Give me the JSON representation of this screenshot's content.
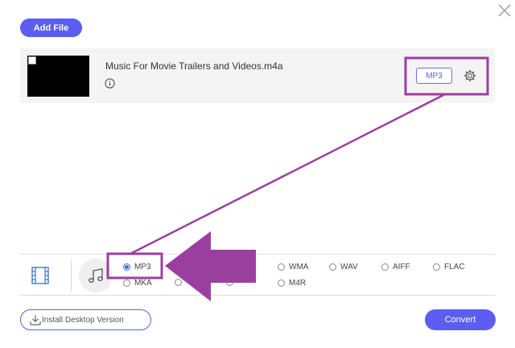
{
  "header": {
    "add_file_label": "Add File"
  },
  "file": {
    "name": "Music For Movie Trailers and Videos.m4a",
    "output_format": "MP3"
  },
  "format_panel": {
    "options": [
      {
        "label": "MP3",
        "selected": true
      },
      {
        "label": "WMA",
        "selected": false
      },
      {
        "label": "WAV",
        "selected": false
      },
      {
        "label": "AIFF",
        "selected": false
      },
      {
        "label": "FLAC",
        "selected": false
      },
      {
        "label": "MKA",
        "selected": false
      },
      {
        "label": "M4R",
        "selected": false
      }
    ]
  },
  "footer": {
    "install_label": "Install Desktop Version",
    "convert_label": "Convert"
  },
  "colors": {
    "accent": "#5b5ef0",
    "annotation": "#9b3f9f"
  }
}
